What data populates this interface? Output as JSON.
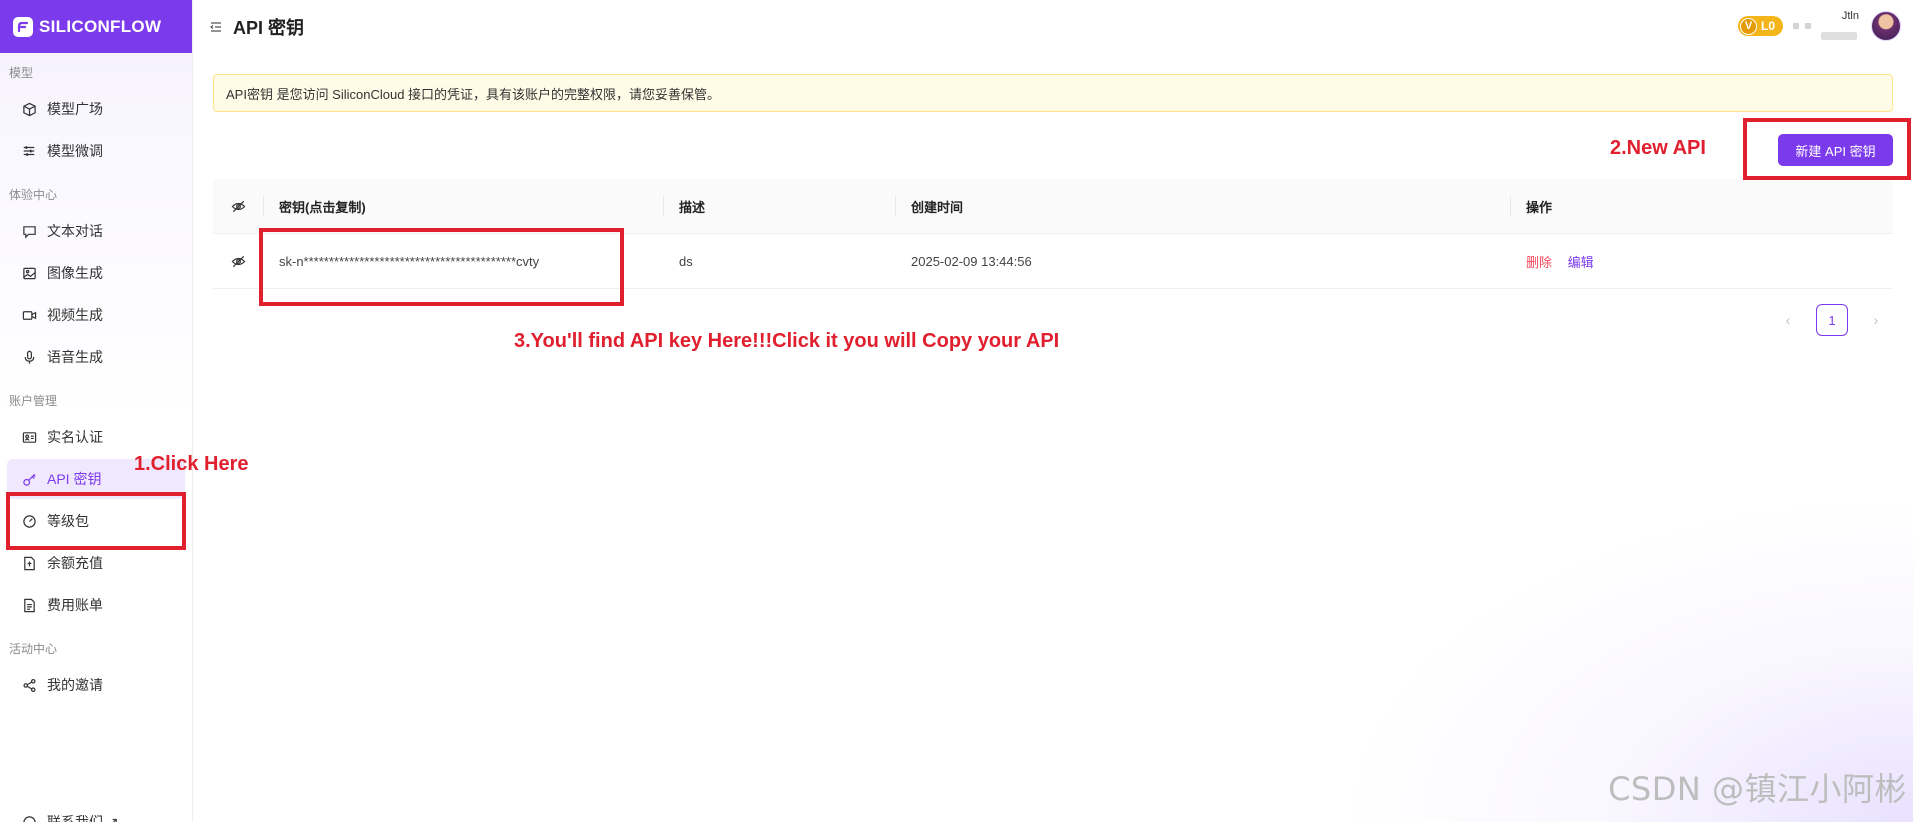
{
  "brand": {
    "name": "SILICONFLOW"
  },
  "header": {
    "title": "API 密钥",
    "level": "L0",
    "level_mark": "V",
    "username": "Jtln"
  },
  "sidebar": {
    "groups": [
      {
        "title": "模型",
        "items": [
          {
            "label": "模型广场",
            "icon": "cube-icon"
          },
          {
            "label": "模型微调",
            "icon": "sliders-icon"
          }
        ]
      },
      {
        "title": "体验中心",
        "items": [
          {
            "label": "文本对话",
            "icon": "chat-icon"
          },
          {
            "label": "图像生成",
            "icon": "image-icon"
          },
          {
            "label": "视频生成",
            "icon": "video-icon"
          },
          {
            "label": "语音生成",
            "icon": "microphone-icon"
          }
        ]
      },
      {
        "title": "账户管理",
        "items": [
          {
            "label": "实名认证",
            "icon": "id-card-icon"
          },
          {
            "label": "API 密钥",
            "icon": "key-icon",
            "active": true
          },
          {
            "label": "等级包",
            "icon": "gauge-icon"
          },
          {
            "label": "余额充值",
            "icon": "wallet-icon"
          },
          {
            "label": "费用账单",
            "icon": "bill-icon"
          }
        ]
      },
      {
        "title": "活动中心",
        "items": [
          {
            "label": "我的邀请",
            "icon": "share-icon"
          }
        ]
      }
    ],
    "footer_item": {
      "label": "联系我们 ↗",
      "icon": "help-icon"
    }
  },
  "notice": {
    "text": "API密钥 是您访问 SiliconCloud 接口的凭证，具有该账户的完整权限，请您妥善保管。"
  },
  "toolbar": {
    "new_key_label": "新建 API 密钥"
  },
  "table": {
    "columns": [
      "密钥(点击复制)",
      "描述",
      "创建时间",
      "操作"
    ],
    "rows": [
      {
        "key": "sk-n******************************************cvty",
        "description": "ds",
        "created": "2025-02-09 13:44:56",
        "delete_label": "删除",
        "edit_label": "编辑"
      }
    ]
  },
  "pagination": {
    "current": "1",
    "prev": "‹",
    "next": "›"
  },
  "annotations": {
    "step1": "1.Click Here",
    "step2": "2.New API",
    "step3": "3.You'll find API key Here!!!Click it you will Copy your API"
  },
  "watermark": "CSDN @镇江小阿彬",
  "colors": {
    "accent": "#7c3aed",
    "annotation": "#e0202e",
    "danger": "#f5485a",
    "badge": "#f3b51a"
  }
}
